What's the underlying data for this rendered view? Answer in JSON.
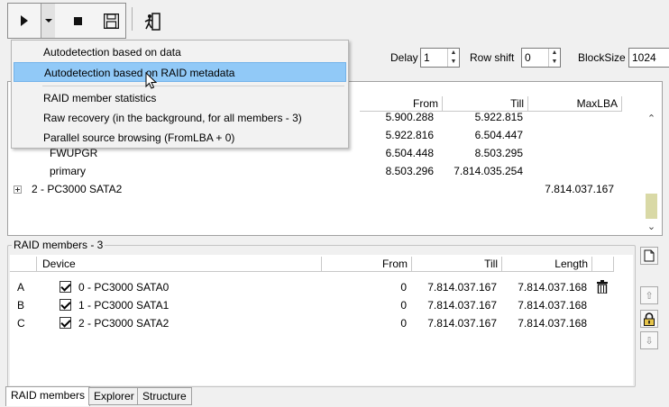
{
  "toolbar": {
    "buttons": [
      {
        "name": "play-icon"
      },
      {
        "name": "chevron-down-icon"
      },
      {
        "name": "stop-icon"
      },
      {
        "name": "save-icon"
      },
      {
        "name": "exit-icon"
      }
    ]
  },
  "params": {
    "delay_label": "Delay",
    "delay_value": "1",
    "rowshift_label": "Row shift",
    "rowshift_value": "0",
    "blocksize_label": "BlockSize",
    "blocksize_value": "1024"
  },
  "menu": {
    "items": [
      {
        "label": "Autodetection based on data",
        "highlighted": false
      },
      {
        "label": "Autodetection based on RAID metadata",
        "highlighted": true
      },
      {
        "label": "RAID member statistics",
        "highlighted": false
      },
      {
        "label": "Raw recovery (in the background, for all members - 3)",
        "highlighted": false
      },
      {
        "label": "Parallel source browsing (FromLBA + 0)",
        "highlighted": false
      }
    ]
  },
  "top_table": {
    "headers": {
      "from": "From",
      "till": "Till",
      "maxlba": "MaxLBA"
    },
    "rows": [
      {
        "name": "",
        "from": "5.900.288",
        "till": "5.922.815",
        "maxlba": ""
      },
      {
        "name": "",
        "from": "5.922.816",
        "till": "6.504.447",
        "maxlba": ""
      },
      {
        "name": "FWUPGR",
        "from": "6.504.448",
        "till": "8.503.295",
        "maxlba": ""
      },
      {
        "name": "primary",
        "from": "8.503.296",
        "till": "7.814.035.254",
        "maxlba": ""
      },
      {
        "name": "2 - PC3000 SATA2",
        "from": "",
        "till": "",
        "maxlba": "7.814.037.167"
      }
    ]
  },
  "members": {
    "title": "RAID members - 3",
    "headers": {
      "device": "Device",
      "from": "From",
      "till": "Till",
      "length": "Length"
    },
    "rows": [
      {
        "letter": "A",
        "device": "0 - PC3000 SATA0",
        "from": "0",
        "till": "7.814.037.167",
        "length": "7.814.037.168"
      },
      {
        "letter": "B",
        "device": "1 - PC3000 SATA1",
        "from": "0",
        "till": "7.814.037.167",
        "length": "7.814.037.168"
      },
      {
        "letter": "C",
        "device": "2 - PC3000 SATA2",
        "from": "0",
        "till": "7.814.037.167",
        "length": "7.814.037.168"
      }
    ]
  },
  "tabs": [
    {
      "label": "RAID members",
      "active": true
    },
    {
      "label": "Explorer",
      "active": false
    },
    {
      "label": "Structure",
      "active": false
    }
  ]
}
